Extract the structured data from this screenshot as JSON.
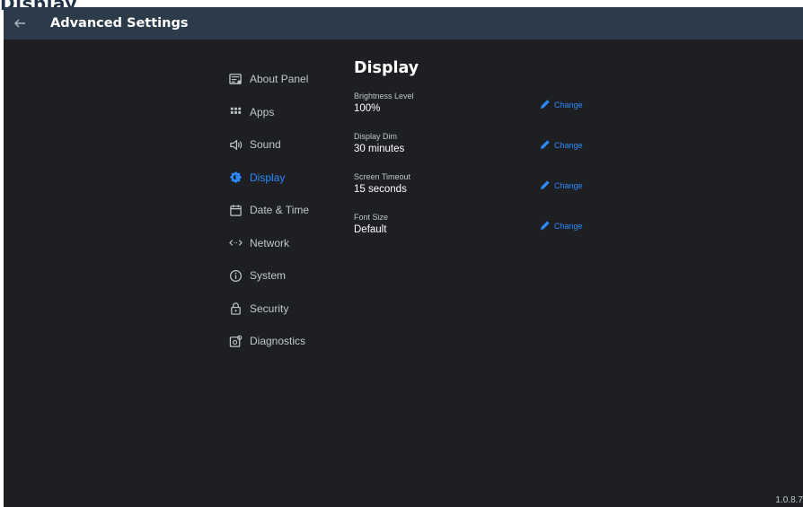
{
  "window_caption": "Display",
  "header": {
    "title": "Advanced Settings"
  },
  "sidebar": {
    "items": [
      {
        "label": "About Panel",
        "icon": "about-panel-icon",
        "active": false
      },
      {
        "label": "Apps",
        "icon": "apps-grid-icon",
        "active": false
      },
      {
        "label": "Sound",
        "icon": "speaker-icon",
        "active": false
      },
      {
        "label": "Display",
        "icon": "display-brightness-icon",
        "active": true
      },
      {
        "label": "Date & Time",
        "icon": "calendar-icon",
        "active": false
      },
      {
        "label": "Network",
        "icon": "network-arrows-icon",
        "active": false
      },
      {
        "label": "System",
        "icon": "info-circle-icon",
        "active": false
      },
      {
        "label": "Security",
        "icon": "lock-icon",
        "active": false
      },
      {
        "label": "Diagnostics",
        "icon": "diagnostics-icon",
        "active": false
      }
    ]
  },
  "main": {
    "title": "Display",
    "settings": [
      {
        "label": "Brightness Level",
        "value": "100%",
        "action": "Change"
      },
      {
        "label": "Display Dim",
        "value": "30 minutes",
        "action": "Change"
      },
      {
        "label": "Screen Timeout",
        "value": "15 seconds",
        "action": "Change"
      },
      {
        "label": "Font Size",
        "value": "Default",
        "action": "Change"
      }
    ]
  },
  "footer": {
    "version": "1.0.8.7"
  },
  "colors": {
    "background": "#1d1f22",
    "header": "#2c3b49",
    "accent": "#2a8bff",
    "text_muted": "#c3c7cc"
  }
}
